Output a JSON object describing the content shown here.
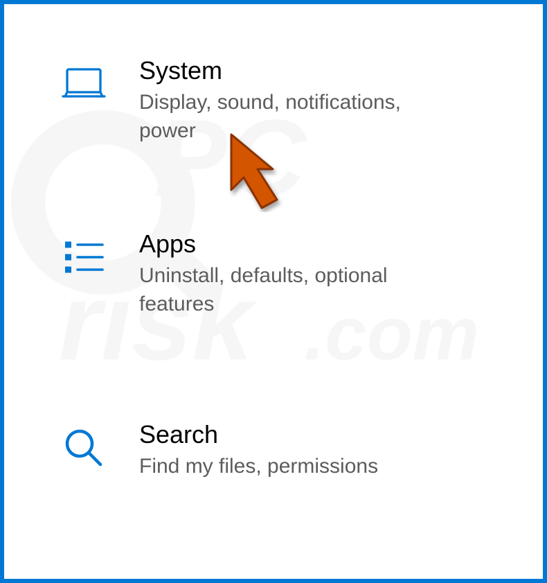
{
  "colors": {
    "accent": "#0078d4",
    "cursor_fill": "#d35400",
    "cursor_stroke": "#8a3200",
    "desc": "#5c5c5c"
  },
  "watermark": "PCrisk.com",
  "tiles": {
    "system": {
      "title": "System",
      "description": "Display, sound, notifications, power",
      "icon": "laptop-icon"
    },
    "apps": {
      "title": "Apps",
      "description": "Uninstall, defaults, optional features",
      "icon": "apps-list-icon"
    },
    "search": {
      "title": "Search",
      "description": "Find my files, permissions",
      "icon": "search-icon"
    }
  }
}
